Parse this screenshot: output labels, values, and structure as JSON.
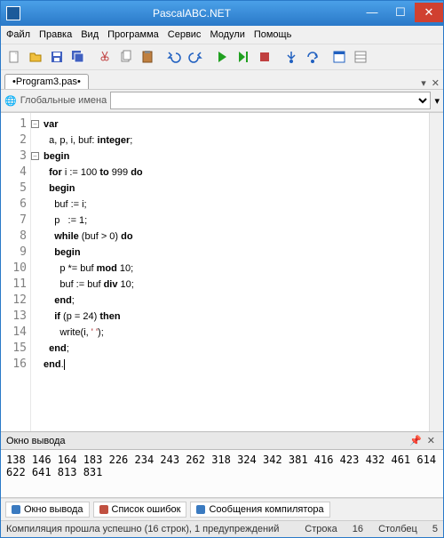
{
  "window": {
    "title": "PascalABC.NET"
  },
  "menu": [
    "Файл",
    "Правка",
    "Вид",
    "Программа",
    "Сервис",
    "Модули",
    "Помощь"
  ],
  "tab": {
    "label": "•Program3.pas•"
  },
  "tabctl": {
    "down": "▾",
    "close": "✕"
  },
  "combo": {
    "label": "Глобальные имена",
    "opt": ""
  },
  "winbtns": {
    "min": "—",
    "max": "☐",
    "close": "✕"
  },
  "code": {
    "lines": [
      {
        "n": "1",
        "fold": "−",
        "t": "var"
      },
      {
        "n": "2",
        "t": "  a, p, i, buf: integer;"
      },
      {
        "n": "3",
        "fold": "−",
        "t": "begin"
      },
      {
        "n": "4",
        "t": "  for i := 100 to 999 do"
      },
      {
        "n": "5",
        "t": "  begin"
      },
      {
        "n": "6",
        "t": "    buf := i;"
      },
      {
        "n": "7",
        "t": "    p   := 1;"
      },
      {
        "n": "8",
        "t": "    while (buf > 0) do"
      },
      {
        "n": "9",
        "t": "    begin"
      },
      {
        "n": "10",
        "t": "      p *= buf mod 10;"
      },
      {
        "n": "11",
        "t": "      buf := buf div 10;"
      },
      {
        "n": "12",
        "t": "    end;"
      },
      {
        "n": "13",
        "t": "    if (p = 24) then"
      },
      {
        "n": "14",
        "t": "      write(i, ' ');"
      },
      {
        "n": "15",
        "t": "  end;"
      },
      {
        "n": "16",
        "t": "end."
      }
    ]
  },
  "output": {
    "title": "Окно вывода",
    "text": "138 146 164 183 226 234 243 262 318 324 342 381 416 423 432 461 614 622 641 813 831"
  },
  "bottabs": [
    {
      "label": "Окно вывода",
      "color": "#3a7ac0"
    },
    {
      "label": "Список ошибок",
      "color": "#c05040"
    },
    {
      "label": "Сообщения компилятора",
      "color": "#3a7ac0"
    }
  ],
  "status": {
    "msg": "Компиляция прошла успешно (16 строк), 1 предупреждений",
    "line_lbl": "Строка",
    "line": "16",
    "col_lbl": "Столбец",
    "col": "5"
  },
  "pin": "📌"
}
